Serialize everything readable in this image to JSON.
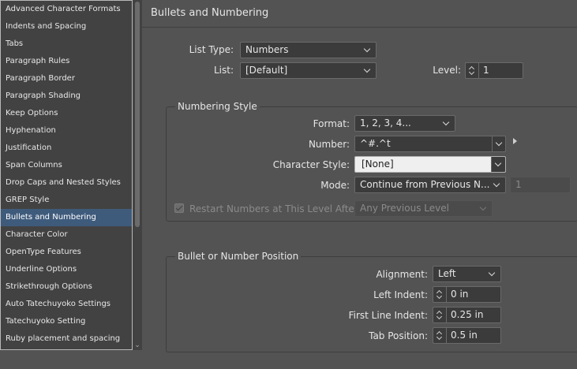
{
  "sidebar": {
    "items": [
      {
        "label": "Advanced Character Formats"
      },
      {
        "label": "Indents and Spacing"
      },
      {
        "label": "Tabs"
      },
      {
        "label": "Paragraph Rules"
      },
      {
        "label": "Paragraph Border"
      },
      {
        "label": "Paragraph Shading"
      },
      {
        "label": "Keep Options"
      },
      {
        "label": "Hyphenation"
      },
      {
        "label": "Justification"
      },
      {
        "label": "Span Columns"
      },
      {
        "label": "Drop Caps and Nested Styles"
      },
      {
        "label": "GREP Style"
      },
      {
        "label": "Bullets and Numbering"
      },
      {
        "label": "Character Color"
      },
      {
        "label": "OpenType Features"
      },
      {
        "label": "Underline Options"
      },
      {
        "label": "Strikethrough Options"
      },
      {
        "label": "Auto Tatechuyoko Settings"
      },
      {
        "label": "Tatechuyoko Setting"
      },
      {
        "label": "Ruby placement and spacing"
      }
    ],
    "selected": "Bullets and Numbering"
  },
  "panel": {
    "heading": "Bullets and Numbering",
    "list_type": {
      "label": "List Type:",
      "value": "Numbers"
    },
    "list": {
      "label": "List:",
      "value": "[Default]"
    },
    "level": {
      "label": "Level:",
      "value": "1"
    }
  },
  "numbering_style": {
    "title": "Numbering Style",
    "format": {
      "label": "Format:",
      "value": "1, 2, 3, 4..."
    },
    "number": {
      "label": "Number:",
      "value": "^#.^t"
    },
    "character_style": {
      "label": "Character Style:",
      "value": "[None]"
    },
    "mode": {
      "label": "Mode:",
      "value": "Continue from Previous N...",
      "start_value": "1"
    },
    "restart": {
      "label": "Restart Numbers at This Level After:",
      "value": "Any Previous Level",
      "checked": true
    }
  },
  "position": {
    "title": "Bullet or Number Position",
    "alignment": {
      "label": "Alignment:",
      "value": "Left"
    },
    "left_indent": {
      "label": "Left Indent:",
      "value": "0 in"
    },
    "first_line_indent": {
      "label": "First Line Indent:",
      "value": "0.25 in"
    },
    "tab_position": {
      "label": "Tab Position:",
      "value": "0.5 in"
    }
  },
  "colors": {
    "background": "#535353",
    "sidebar_bg": "#424242",
    "selected_row": "#3f5b7c"
  }
}
